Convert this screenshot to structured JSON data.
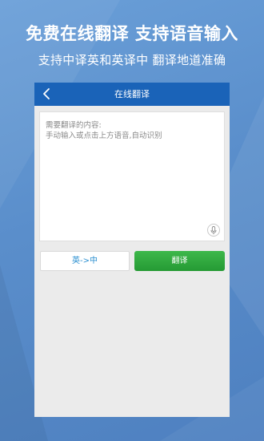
{
  "promo": {
    "headline": "免费在线翻译  支持语音输入",
    "subline": "支持中译英和英译中  翻译地道准确"
  },
  "app": {
    "title": "在线翻译",
    "input": {
      "value": "",
      "placeholder": "需要翻译的内容:\n手动输入或点击上方语音,自动识别"
    },
    "direction_label": "英->中",
    "translate_label": "翻译"
  },
  "icons": {
    "back": "chevron-left-icon",
    "mic": "microphone-icon"
  },
  "colors": {
    "titlebar": "#1a63b8",
    "translate_button": "#2fa83e",
    "direction_text": "#2a8fd0",
    "background": "#5a8ecb"
  }
}
